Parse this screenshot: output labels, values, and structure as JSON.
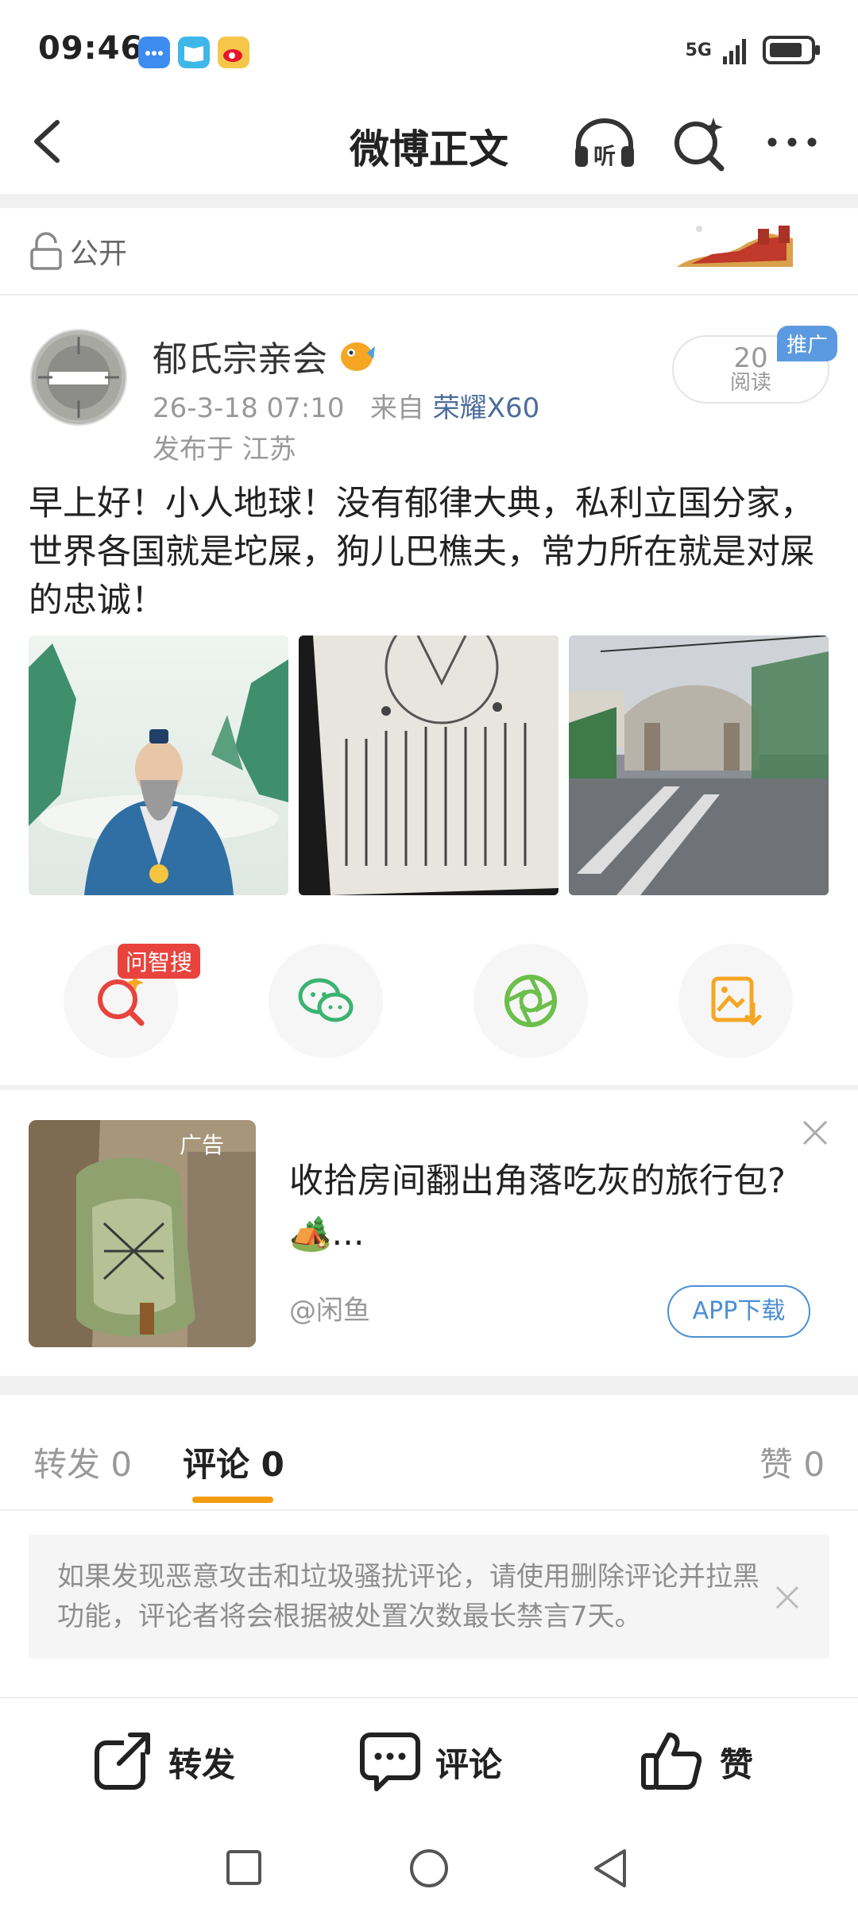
{
  "status_bar": {
    "time": "09:46",
    "network": "5G"
  },
  "nav": {
    "title": "微博正文"
  },
  "visibility": {
    "label": "公开"
  },
  "post": {
    "author": "郁氏宗亲会",
    "time": "26-3-18 07:10",
    "source_prefix": "来自",
    "source": "荣耀X60",
    "location": "发布于 江苏",
    "reads": "20",
    "reads_label": "阅读",
    "promo_badge": "推广",
    "text": "早上好！小人地球！没有郁律大典，私利立国分家，世界各国就是坨屎，狗儿巴樵夫，常力所在就是对屎的忠诚！",
    "images": [
      "sage-painting",
      "ancient-text-page",
      "street-gate-photo"
    ]
  },
  "actions": {
    "ai_search_tag": "问智搜"
  },
  "ad": {
    "tag": "广告",
    "title": "收拾房间翻出角落吃灰的旅行包?🏕️...",
    "source": "@闲鱼",
    "button": "APP下载"
  },
  "tabs": [
    {
      "label": "转发 0"
    },
    {
      "label": "评论 0"
    },
    {
      "label": "赞 0"
    }
  ],
  "notice": "如果发现恶意攻击和垃圾骚扰评论，请使用删除评论并拉黑功能，评论者将会根据被处置次数最长禁言7天。",
  "bottom_bar": {
    "repost": "转发",
    "comment": "评论",
    "like": "赞"
  },
  "colors": {
    "accent": "#f39c12",
    "link": "#4c6c9c",
    "ad_button": "#4c8fd4",
    "ai_tag": "#e8433d"
  }
}
